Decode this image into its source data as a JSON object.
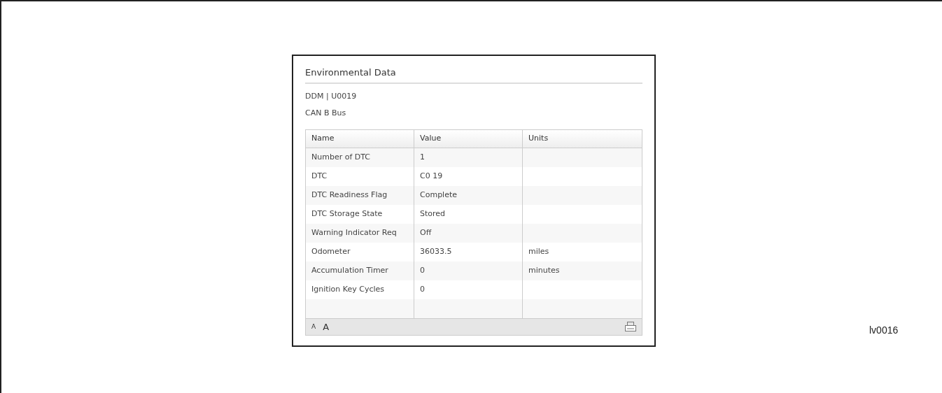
{
  "panel": {
    "title": "Environmental Data",
    "subtitle_lines": [
      "DDM | U0019",
      "CAN B Bus"
    ]
  },
  "table": {
    "columns": [
      "Name",
      "Value",
      "Units"
    ],
    "rows": [
      [
        "Number of DTC",
        "1",
        ""
      ],
      [
        "DTC",
        "C0 19",
        ""
      ],
      [
        "DTC Readiness Flag",
        "Complete",
        ""
      ],
      [
        "DTC Storage State",
        "Stored",
        ""
      ],
      [
        "Warning Indicator Req",
        "Off",
        ""
      ],
      [
        "Odometer",
        "36033.5",
        "miles"
      ],
      [
        "Accumulation Timer",
        "0",
        "minutes"
      ],
      [
        "Ignition Key Cycles",
        "0",
        ""
      ]
    ]
  },
  "footer": {
    "font_buttons": [
      "A",
      "A"
    ]
  },
  "figure_label": "lv0016"
}
